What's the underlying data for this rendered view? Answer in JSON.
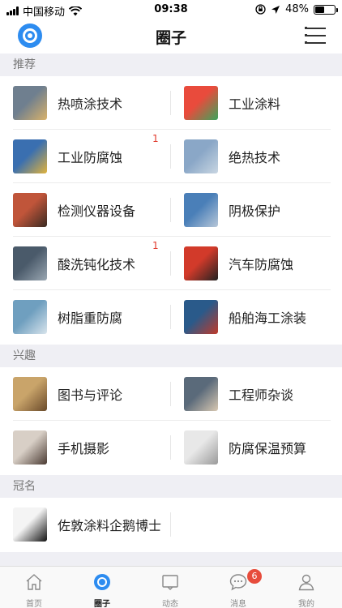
{
  "status_bar": {
    "carrier": "中国移动",
    "time": "09:38",
    "battery": "48%",
    "battery_level": 0.48
  },
  "navbar": {
    "title": "圈子",
    "left_icon": "logo-icon",
    "right_icon": "menu-icon"
  },
  "sections": [
    {
      "title": "推荐",
      "items": [
        {
          "label": "热喷涂技术",
          "count": "",
          "thumb": [
            "#6f7f8f",
            "#d9b26a"
          ]
        },
        {
          "label": "工业涂料",
          "count": "",
          "thumb": [
            "#e94b3c",
            "#3ba55c"
          ]
        },
        {
          "label": "工业防腐蚀",
          "count": "1",
          "thumb": [
            "#3a6fb0",
            "#e1b33c"
          ]
        },
        {
          "label": "绝热技术",
          "count": "",
          "thumb": [
            "#8aa7c7",
            "#c9d6e2"
          ]
        },
        {
          "label": "检测仪器设备",
          "count": "",
          "thumb": [
            "#c0553a",
            "#3a2a22"
          ]
        },
        {
          "label": "阴极保护",
          "count": "",
          "thumb": [
            "#4a7fb8",
            "#b7c7d8"
          ]
        },
        {
          "label": "酸洗钝化技术",
          "count": "1",
          "thumb": [
            "#4a5a6a",
            "#9aa7b2"
          ]
        },
        {
          "label": "汽车防腐蚀",
          "count": "",
          "thumb": [
            "#d23a2a",
            "#222222"
          ]
        },
        {
          "label": "树脂重防腐",
          "count": "",
          "thumb": [
            "#6f9fbf",
            "#d8e4ec"
          ]
        },
        {
          "label": "船舶海工涂装",
          "count": "",
          "thumb": [
            "#2a5a8a",
            "#c03a2a"
          ]
        }
      ]
    },
    {
      "title": "兴趣",
      "items": [
        {
          "label": "图书与评论",
          "count": "",
          "thumb": [
            "#c9a46a",
            "#6a4a2a"
          ]
        },
        {
          "label": "工程师杂谈",
          "count": "",
          "thumb": [
            "#5a6a7a",
            "#d8c8b2"
          ]
        },
        {
          "label": "手机摄影",
          "count": "",
          "thumb": [
            "#d8cfc6",
            "#4a3a32"
          ]
        },
        {
          "label": "防腐保温预算",
          "count": "",
          "thumb": [
            "#e8e8e8",
            "#9a9a9a"
          ]
        }
      ]
    },
    {
      "title": "冠名",
      "items": [
        {
          "label": "佐敦涂料企鹅博士",
          "count": "",
          "thumb": [
            "#f4f4f4",
            "#111111"
          ]
        }
      ]
    }
  ],
  "tabbar": {
    "tabs": [
      {
        "label": "首页",
        "icon": "home-icon",
        "active": false
      },
      {
        "label": "圈子",
        "icon": "circle-icon",
        "active": true
      },
      {
        "label": "动态",
        "icon": "feed-icon",
        "active": false
      },
      {
        "label": "消息",
        "icon": "chat-icon",
        "active": false
      },
      {
        "label": "我的",
        "icon": "user-icon",
        "active": false
      }
    ],
    "message_badge": "6"
  },
  "colors": {
    "accent": "#2d8cf0",
    "section_bg": "#efeff4",
    "badge": "#e74c3c",
    "count": "#e0392b"
  }
}
